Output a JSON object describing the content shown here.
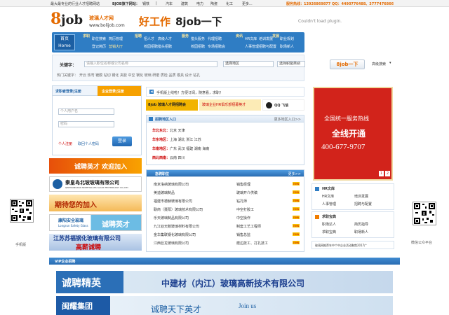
{
  "topbar": {
    "slogan": "最大最专业的行业人才招聘网站",
    "flag_label": "BJOB旗下网站：",
    "links": [
      "钢铁",
      "汽车",
      "建筑",
      "电力",
      "陶瓷",
      "化工",
      "更多..."
    ],
    "hotline": "服务热线：13926869877 QQ：4490776488、3777476866"
  },
  "header": {
    "logo_mark": "8",
    "logo_text": "job",
    "logo_cn": "玻璃人才网",
    "logo_url": "www.bolijob.com",
    "slogan1": "好工作",
    "slogan2": "8job一下",
    "plugin_msg": "Couldn't load plugin."
  },
  "nav": {
    "home": "首页",
    "home_en": "Home",
    "groups": [
      {
        "title": "求职",
        "items": [
          "职位搜索",
          "简历管理",
          "登记简历",
          "猎头服务",
          "高级人才",
          "营销大厅"
        ]
      },
      {
        "title": "招聘",
        "items": [
          "招人才",
          "高级人才",
          "校园招聘",
          "猎头招聘"
        ]
      },
      {
        "title": "服务",
        "items": [
          "猎头服务",
          "代理招聘",
          "校园招聘",
          "专场招聘会"
        ]
      },
      {
        "title": "资讯",
        "items": [
          "HR文库",
          "培训发展",
          "人事管理",
          "招聘与配置"
        ]
      },
      {
        "title": "发展",
        "items": [
          "职业规划",
          "求职宝典",
          "面试技巧",
          "职场新人"
        ]
      }
    ]
  },
  "search": {
    "keyword_label": "关键字：",
    "keyword_placeholder": "请输入职位名称或公司名称",
    "region": "选择地区",
    "category": "选择职能类别",
    "button": "8job一下",
    "advanced": "高级搜索",
    "hot_label": "热门关键字：",
    "hot_words": "开云 热弯 镀膜 钻切 钢化 夹胶 中空 钢化 玻璃 研磨 质检 品质 模具 设计 钻孔"
  },
  "login": {
    "tab1": "求职者登录|注册",
    "tab2": "企业登录|注册",
    "user_placeholder": "个人用户名",
    "pwd_placeholder": "密码",
    "register": "个人注册",
    "forgot": "取回个人密码",
    "login_btn": "登录"
  },
  "left_ads": {
    "ad1": "诚聘英才  欢迎加入",
    "ad2_cn": "秦皇岛北玻玻璃有限公司",
    "ad2_en": "QINHUANGDAO NORTHGLASS GLASS TECHNOLOGY CO.,LTD",
    "ad3": "期待您的加入",
    "ad4_cn": "康阳安全玻璃",
    "ad4_en": "Longrun Safety Glass",
    "ad4_tag": "诚聘英才",
    "ad5": "江苏苏福钢化玻璃有限公司",
    "ad5_tag": "高薪诚聘"
  },
  "mid": {
    "notice": "手机版上线啦！方便订阅，随意看，求职！",
    "promo_left": "8job 玻璃人才网招聘会",
    "promo_mid": "玻璃企业HR俱乐部招募英才",
    "promo_qq": "QQ 飞信",
    "region_title": "招聘地区入口",
    "more_regions": "更多地区入口>>",
    "regions": [
      {
        "name": "华北东北：",
        "items": "北京 天津"
      },
      {
        "name": "华东地区：",
        "items": "上海 湖北 浙江 江苏"
      },
      {
        "name": "华南地区：",
        "items": "广东 武汉 福建 湖南 海南"
      },
      {
        "name": "西北西南：",
        "items": "云南 四川"
      }
    ],
    "jobs_title": "急聘职位",
    "more_jobs": "更多>>",
    "jobs": [
      {
        "company": "南京洛纳玻璃有限公司",
        "position": "销售经理"
      },
      {
        "company": "美迪玻璃制品",
        "position": "玻璃开介供稿"
      },
      {
        "company": "福建市德赫玻璃有限公司",
        "position": "钻孔师"
      },
      {
        "company": "联商（聂阳）玻璃技术有限公司",
        "position": "中空打胶工"
      },
      {
        "company": "乐天玻璃制品有限公司",
        "position": "中空操作"
      },
      {
        "company": "九江亚天鹅玻璃材料有限公司",
        "position": "制套工艺工程师"
      },
      {
        "company": "金华集联钢化玻璃有限公司",
        "position": "销售总监"
      },
      {
        "company": "江西巨龙玻璃有限公司",
        "position": "磨边技工、打孔技工"
      }
    ],
    "hot_tag": "new"
  },
  "right": {
    "ad_line1": "全国统一服务热线",
    "ad_line2": "全线开通",
    "ad_phone": "400-677-9707",
    "ad_pages": [
      "1",
      "2"
    ],
    "hr_title": "HR文库",
    "hr_items": [
      "HR文库",
      "培训发展",
      "人事管理",
      "招聘与配置"
    ],
    "job_title": "求职宝典",
    "job_items": [
      "职场达人",
      "简历指导",
      "求职宝典",
      "职场新人"
    ],
    "news": "玻璃网推荐年中个中企业活动聚焦2017广"
  },
  "qr": {
    "left_caption": "手机版",
    "right_caption": "微信公众平台"
  },
  "vip": {
    "title": "VIP企业招聘",
    "ad1_left": "诚聘精英",
    "ad1_right": "中建材（内江）玻璃高新技术有限公司",
    "ad2_left": "闽耀集团",
    "ad2_mid": "诚聘天下英才",
    "ad2_right": "Join us"
  },
  "colors": {
    "nav_blue": "#2f7dc4",
    "accent_orange": "#f07d00",
    "ad_red": "#d2231b"
  }
}
